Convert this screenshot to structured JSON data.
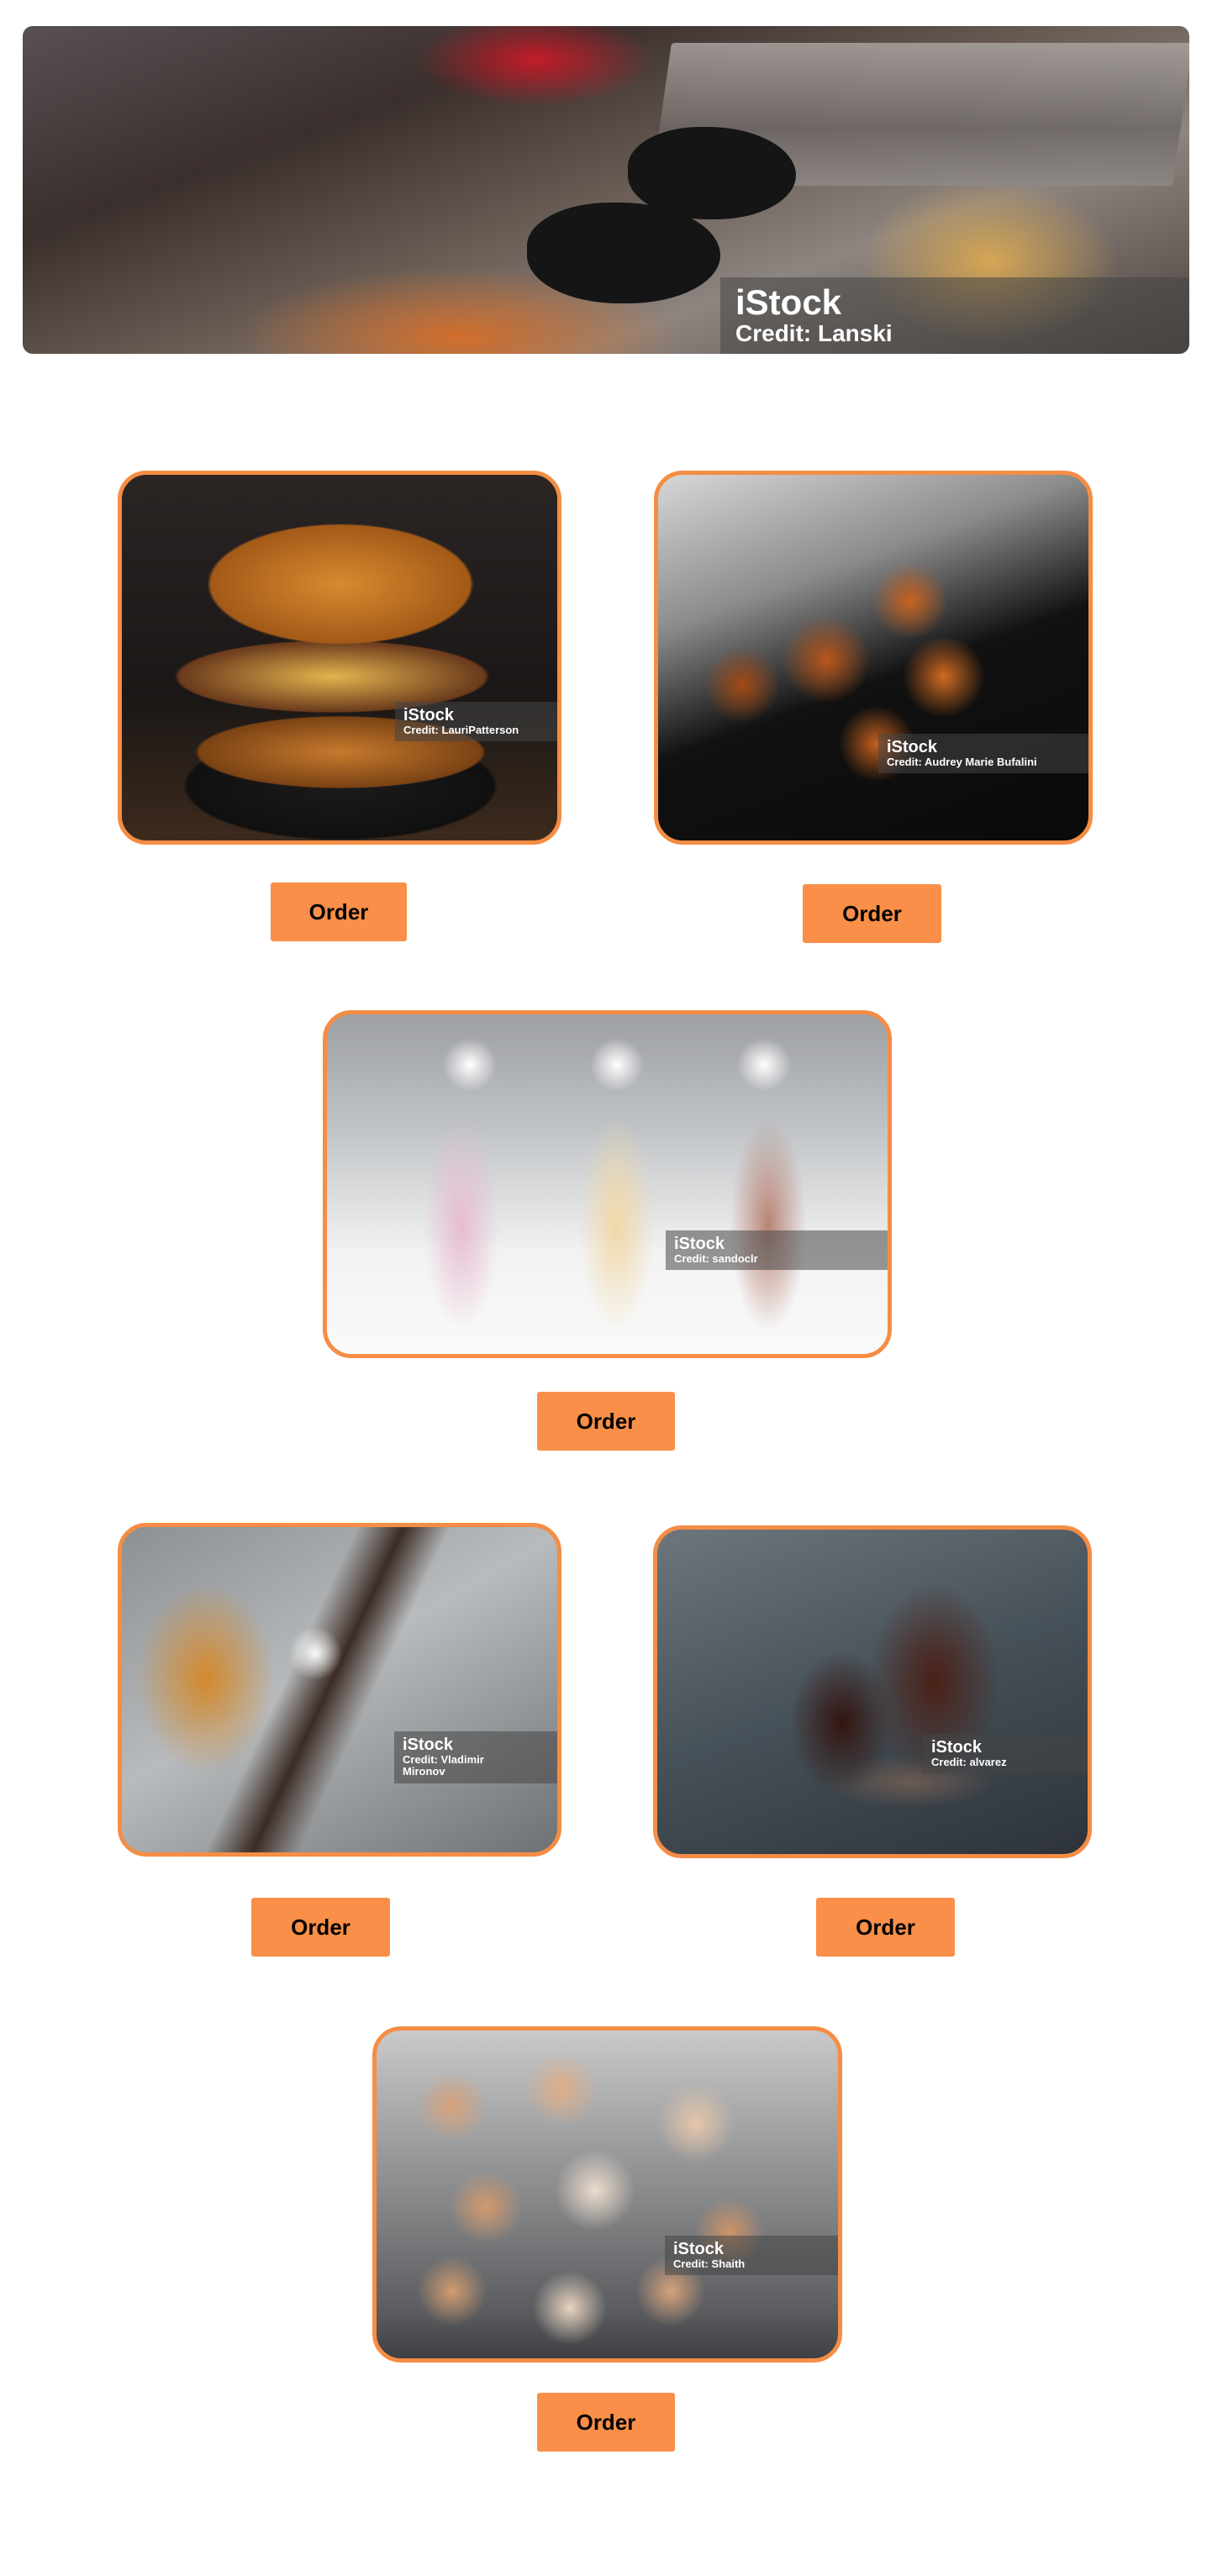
{
  "hero": {
    "credit_brand": "iStock",
    "credit_text": "Credit: Lanski"
  },
  "cards": {
    "burger": {
      "credit_brand": "iStock",
      "credit_text": "Credit: LauriPatterson",
      "order_label": "Order"
    },
    "pretzels": {
      "credit_brand": "iStock",
      "credit_text": "Credit: Audrey Marie Bufalini",
      "order_label": "Order"
    },
    "milkshakes": {
      "credit_brand": "iStock",
      "credit_text": "Credit: sandoclr",
      "order_label": "Order"
    },
    "churros": {
      "credit_brand": "iStock",
      "credit_text": "Credit: Vladimir Mironov",
      "order_label": "Order"
    },
    "brownies": {
      "credit_brand": "iStock",
      "credit_text": "Credit: alvarez",
      "order_label": "Order"
    },
    "donuts": {
      "credit_brand": "iStock",
      "credit_text": "Credit: Shaith",
      "order_label": "Order"
    }
  },
  "colors": {
    "accent": "#f98f48",
    "card_border": "#f58d44"
  }
}
